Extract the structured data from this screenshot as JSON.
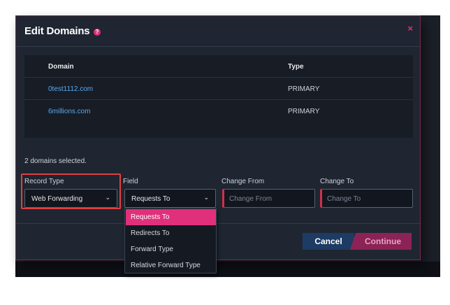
{
  "modal": {
    "title": "Edit Domains",
    "help_icon": "?",
    "close_icon": "×"
  },
  "table": {
    "headers": {
      "domain": "Domain",
      "type": "Type"
    },
    "rows": [
      {
        "domain": "0test1112.com",
        "type": "PRIMARY"
      },
      {
        "domain": "6millions.com",
        "type": "PRIMARY"
      }
    ]
  },
  "selected_count": "2 domains selected.",
  "form": {
    "record_type": {
      "label": "Record Type",
      "value": "Web Forwarding"
    },
    "field": {
      "label": "Field",
      "value": "Requests To"
    },
    "change_from": {
      "label": "Change From",
      "placeholder": "Change From"
    },
    "change_to": {
      "label": "Change To",
      "placeholder": "Change To"
    }
  },
  "dropdown_options": [
    "Requests To",
    "Redirects To",
    "Forward Type",
    "Relative Forward Type"
  ],
  "buttons": {
    "cancel": "Cancel",
    "continue": "Continue"
  },
  "colors": {
    "accent": "#e0307c",
    "link": "#5aa9ee",
    "cancel_bg": "#1d3b63",
    "continue_bg": "#8b2357",
    "highlight": "#e04040"
  },
  "icons": {
    "chevron": "chevron-down-icon",
    "help": "help-icon",
    "close": "close-icon"
  }
}
